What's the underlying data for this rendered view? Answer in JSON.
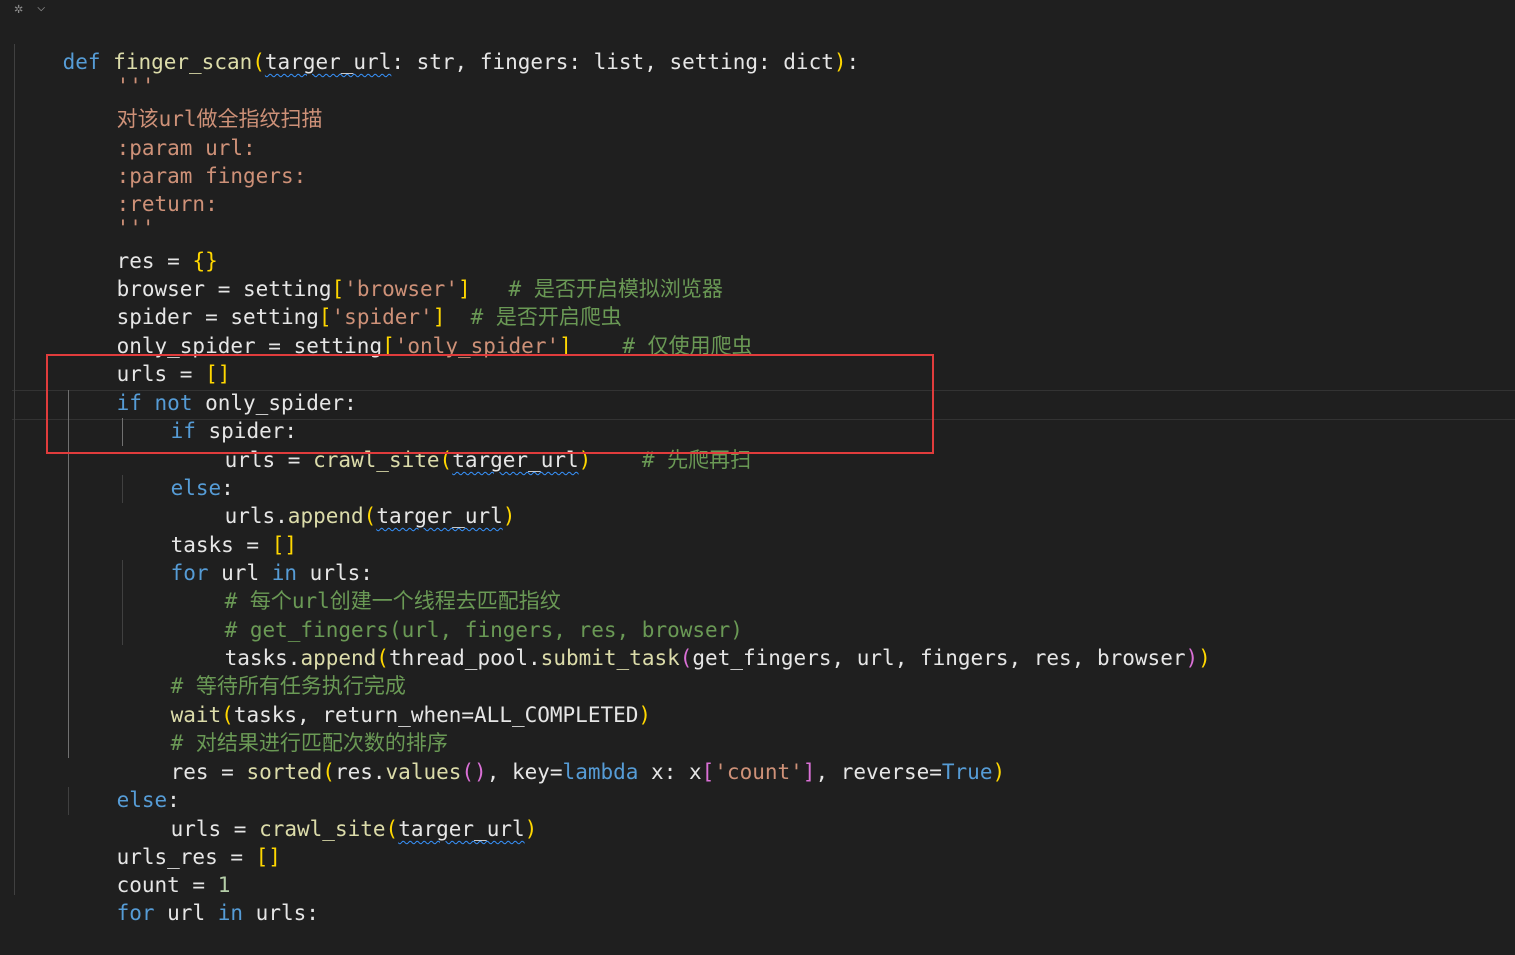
{
  "icons": {
    "lens": "lens-icon",
    "chevron": "chevron-down-icon"
  },
  "colors": {
    "background": "#1f1f1f",
    "keyword": "#569cd6",
    "function": "#dcdcaa",
    "string": "#ce9178",
    "comment": "#6a9955",
    "highlight_box": "#e03c3c"
  },
  "code": {
    "l1": {
      "def": "def",
      "name": "finger_scan",
      "p_open": "(",
      "param1": "targer_url",
      "rest": ": str, fingers: list, setting: dict",
      "p_close": ")",
      "colon": ":"
    },
    "l2": {
      "doc": "'''"
    },
    "l3": {
      "doc": "对该url做全指纹扫描"
    },
    "l4": {
      "doc": ":param url:"
    },
    "l5": {
      "doc": ":param fingers:"
    },
    "l6": {
      "doc": ":return:"
    },
    "l7": {
      "doc": "'''"
    },
    "l8": {
      "var": "res = ",
      "br": "{}"
    },
    "l9": {
      "a": "browser = setting",
      "b1": "[",
      "s": "'browser'",
      "b2": "]",
      "c": "   # 是否开启模拟浏览器"
    },
    "l10": {
      "a": "spider = setting",
      "b1": "[",
      "s": "'spider'",
      "b2": "]",
      "c": "  # 是否开启爬虫"
    },
    "l11": {
      "a": "only_spider = setting",
      "b1": "[",
      "s": "'only_spider'",
      "b2": "]",
      "c": "    # 仅使用爬虫"
    },
    "l12": {
      "a": "urls = ",
      "br": "[]"
    },
    "l13": {
      "kw1": "if",
      "kw2": "not",
      "rest": " only_spider:"
    },
    "l14": {
      "kw1": "if",
      "rest": " spider:"
    },
    "l15": {
      "a": "urls = ",
      "fn": "crawl_site",
      "p1": "(",
      "arg": "targer_url",
      "p2": ")",
      "c": "    # 先爬再扫"
    },
    "l16": {
      "kw1": "else",
      "rest": ":"
    },
    "l17": {
      "a": "urls.",
      "fn": "append",
      "p1": "(",
      "arg": "targer_url",
      "p2": ")"
    },
    "l18": {
      "a": "tasks = ",
      "br": "[]"
    },
    "l19": {
      "kw1": "for",
      "mid": " url ",
      "kw2": "in",
      "rest": " urls:"
    },
    "l20": {
      "c": "# 每个url创建一个线程去匹配指纹"
    },
    "l21": {
      "c": "# get_fingers(url, fingers, res, browser)"
    },
    "l22": {
      "a": "tasks.",
      "fn": "append",
      "p1": "(",
      "b": "thread_pool.",
      "fn2": "submit_task",
      "p3": "(",
      "c": "get_fingers, url, fingers, res, browser",
      "p4": ")",
      "p2": ")"
    },
    "l23": {
      "c": "# 等待所有任务执行完成"
    },
    "l24": {
      "fn": "wait",
      "p1": "(",
      "a": "tasks, return_when=ALL_COMPLETED",
      "p2": ")"
    },
    "l25": {
      "c": "# 对结果进行匹配次数的排序"
    },
    "l26": {
      "a": "res = ",
      "fn": "sorted",
      "p1": "(",
      "b": "res.",
      "fn2": "values",
      "p3": "()",
      "c": ", key=",
      "kw": "lambda",
      "d": " x: x",
      "b1": "[",
      "s": "'count'",
      "b2": "]",
      "e": ", reverse=",
      "kw2": "True",
      "p2": ")"
    },
    "l27": {
      "kw1": "else",
      "rest": ":"
    },
    "l28": {
      "a": "urls = ",
      "fn": "crawl_site",
      "p1": "(",
      "arg": "targer_url",
      "p2": ")"
    },
    "l29": {
      "a": "urls_res = ",
      "br": "[]"
    },
    "l30": {
      "a": "count = ",
      "num": "1"
    },
    "l31": {
      "kw1": "for",
      "mid": " url ",
      "kw2": "in",
      "rest": " urls:"
    }
  }
}
